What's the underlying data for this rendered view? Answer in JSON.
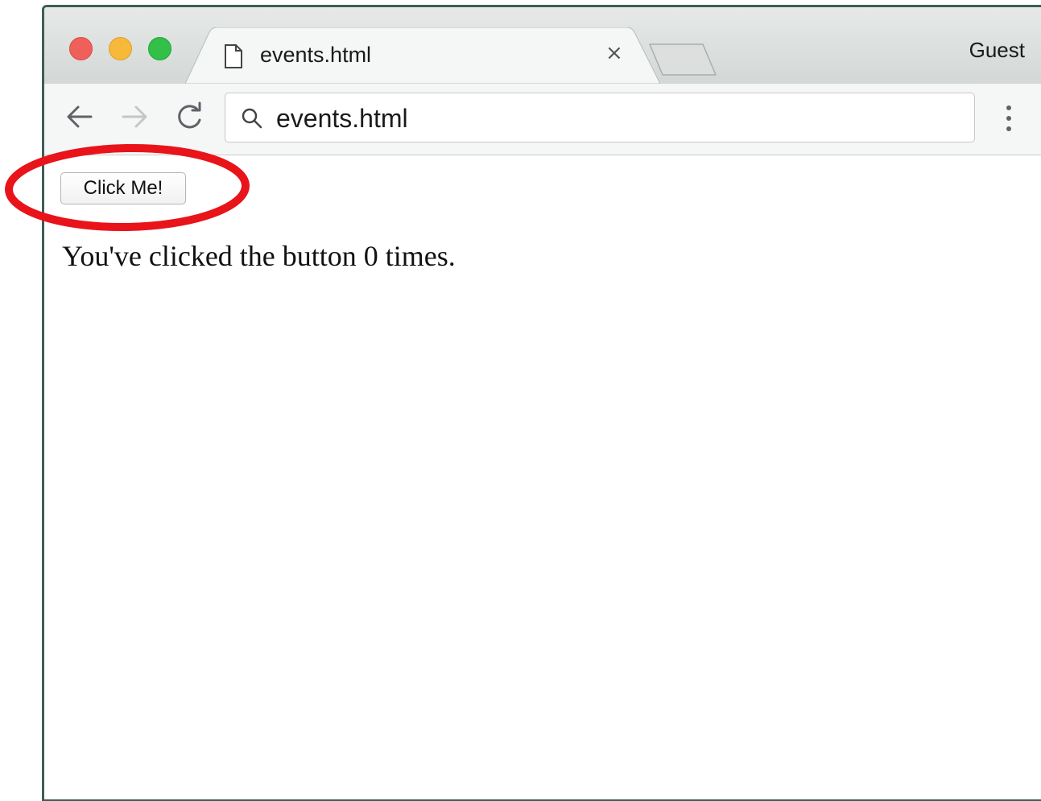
{
  "browser": {
    "tab": {
      "title": "events.html",
      "close_glyph": "×",
      "icon": "page-icon"
    },
    "profile_label": "Guest",
    "address_bar": {
      "value": "events.html",
      "icon": "search-icon"
    },
    "nav": {
      "back_icon": "arrow-left-icon",
      "forward_icon": "arrow-right-icon",
      "reload_icon": "reload-icon",
      "menu_icon": "more-vertical-icon"
    },
    "window_controls": [
      "close",
      "minimize",
      "zoom"
    ]
  },
  "page": {
    "button_label": "Click Me!",
    "counter_text": "You've clicked the button 0 times.",
    "click_count": 0
  },
  "annotation": {
    "shape": "ellipse",
    "color": "#e8141a",
    "target": "Click Me! button"
  },
  "colors": {
    "traffic_red": "#f0605a",
    "traffic_yellow": "#f6b93a",
    "traffic_green": "#33c048",
    "annotation_red": "#e8141a"
  }
}
